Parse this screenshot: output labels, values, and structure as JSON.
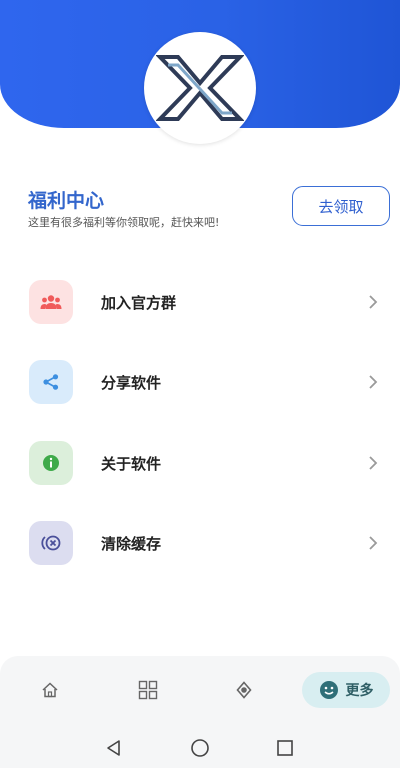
{
  "welfare": {
    "title": "福利中心",
    "subtitle": "这里有很多福利等你领取呢，赶快来吧!",
    "claim_button": "去领取"
  },
  "menu": [
    {
      "label": "加入官方群",
      "icon": "group-icon",
      "color": "#f05a5a",
      "bg": "#fde2e2"
    },
    {
      "label": "分享软件",
      "icon": "share-icon",
      "color": "#3d8fe0",
      "bg": "#d9ebfb"
    },
    {
      "label": "关于软件",
      "icon": "info-icon",
      "color": "#3faa4a",
      "bg": "#dcefdb"
    },
    {
      "label": "清除缓存",
      "icon": "clear-cache-icon",
      "color": "#4a4f9a",
      "bg": "#dcddf0"
    }
  ],
  "bottom_nav": {
    "tabs": [
      {
        "name": "home",
        "icon": "home-icon"
      },
      {
        "name": "apps",
        "icon": "grid-icon"
      },
      {
        "name": "discover",
        "icon": "compass-icon"
      },
      {
        "name": "more",
        "icon": "smile-icon",
        "label": "更多",
        "active": true
      }
    ]
  },
  "colors": {
    "header_blue": "#2f66ee",
    "accent_blue": "#3366cc",
    "active_tab_bg": "#d8eef1"
  }
}
